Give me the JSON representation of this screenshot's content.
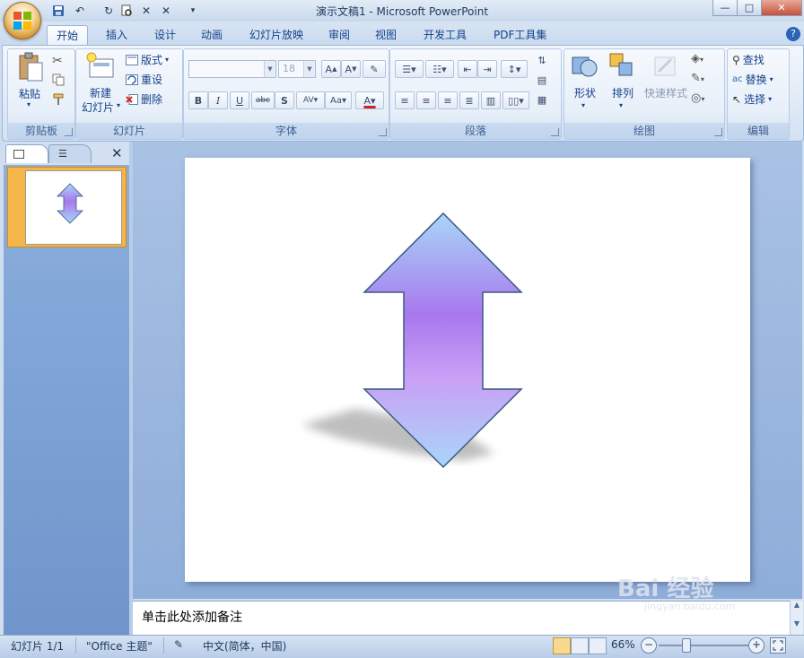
{
  "window": {
    "title": "演示文稿1 - Microsoft PowerPoint"
  },
  "tabs": [
    {
      "label": "开始",
      "active": true
    },
    {
      "label": "插入"
    },
    {
      "label": "设计"
    },
    {
      "label": "动画"
    },
    {
      "label": "幻灯片放映"
    },
    {
      "label": "审阅"
    },
    {
      "label": "视图"
    },
    {
      "label": "开发工具"
    },
    {
      "label": "PDF工具集"
    }
  ],
  "ribbon": {
    "clipboard": {
      "label": "剪贴板",
      "paste": "粘贴"
    },
    "slides": {
      "label": "幻灯片",
      "new_slide_line1": "新建",
      "new_slide_line2": "幻灯片",
      "layout": "版式",
      "reset": "重设",
      "delete": "删除"
    },
    "font": {
      "label": "字体",
      "font_size": "18"
    },
    "paragraph": {
      "label": "段落"
    },
    "drawing": {
      "label": "绘图",
      "shapes": "形状",
      "arrange": "排列",
      "quick_styles": "快速样式"
    },
    "editing": {
      "label": "编辑",
      "find": "查找",
      "replace": "替换",
      "select": "选择"
    }
  },
  "slide_panel": {
    "slide_number": "1"
  },
  "notes": {
    "placeholder": "单击此处添加备注"
  },
  "status": {
    "slide_counter": "幻灯片 1/1",
    "theme": "\"Office 主题\"",
    "language": "中文(简体，中国)",
    "zoom": "66%"
  },
  "watermark": {
    "brand": "Bai 经验",
    "url": "jingyan.baidu.com"
  },
  "colors": {
    "arrow_top": "#a8d6f8",
    "arrow_mid": "#a878ee",
    "arrow_outline": "#3a5a80",
    "thumb_selected": "#f5b548"
  }
}
